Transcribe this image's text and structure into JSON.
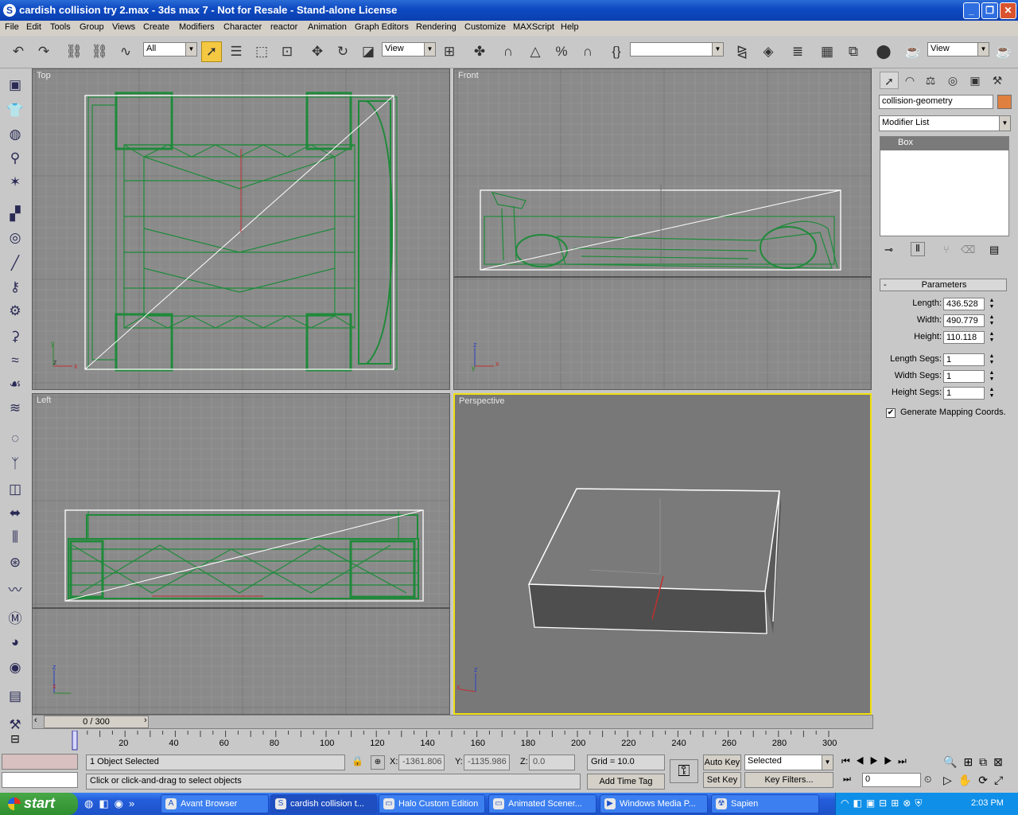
{
  "window": {
    "title": "cardish collision try 2.max - 3ds max 7  - Not for Resale - Stand-alone License"
  },
  "menu": [
    "File",
    "Edit",
    "Tools",
    "Group",
    "Views",
    "Create",
    "Modifiers",
    "Character",
    "reactor",
    "Animation",
    "Graph Editors",
    "Rendering",
    "Customize",
    "MAXScript",
    "Help"
  ],
  "toolbar": {
    "selection_filter": "All",
    "ref_coord_1": "View",
    "named_sel": "",
    "ref_coord_2": "View"
  },
  "viewports": {
    "top": "Top",
    "front": "Front",
    "left": "Left",
    "perspective": "Perspective"
  },
  "command_panel": {
    "object_name": "collision-geometry",
    "object_color": "#e08040",
    "modifier_list": "Modifier List",
    "stack_item": "Box",
    "rollout_title": "Parameters",
    "rollout_toggle": "-",
    "params": [
      {
        "label": "Length:",
        "value": "436.528"
      },
      {
        "label": "Width:",
        "value": "490.779"
      },
      {
        "label": "Height:",
        "value": "110.118"
      },
      {
        "label": "Length Segs:",
        "value": "1"
      },
      {
        "label": "Width Segs:",
        "value": "1"
      },
      {
        "label": "Height Segs:",
        "value": "1"
      }
    ],
    "generate_mapping": {
      "label": "Generate Mapping Coords.",
      "checked": true
    }
  },
  "timeline": {
    "slider_label": "0 / 300",
    "ticks": [
      "20",
      "40",
      "60",
      "80",
      "100",
      "120",
      "140",
      "160",
      "180",
      "200",
      "220",
      "240",
      "260",
      "280",
      "300"
    ]
  },
  "status": {
    "selected": "1 Object Selected",
    "prompt": "Click or click-and-drag to select objects",
    "x_label": "X:",
    "x": "-1361.806",
    "y_label": "Y:",
    "y": "-1135.986",
    "z_label": "Z:",
    "z": "0.0",
    "grid": "Grid = 10.0",
    "add_time_tag": "Add Time Tag",
    "auto_key": "Auto Key",
    "set_key": "Set Key",
    "key_mode": "Selected",
    "key_filters": "Key Filters...",
    "frame": "0"
  },
  "taskbar": {
    "start": "start",
    "tasks": [
      "Avant Browser",
      "cardish collision t...",
      "Halo Custom Edition",
      "Animated Scener...",
      "Windows Media P...",
      "Sapien"
    ],
    "clock": "2:03 PM"
  },
  "colors": {
    "wire": "#1f8a3a",
    "box_edge": "#ffffff",
    "active_viewport": "#f0e010"
  }
}
